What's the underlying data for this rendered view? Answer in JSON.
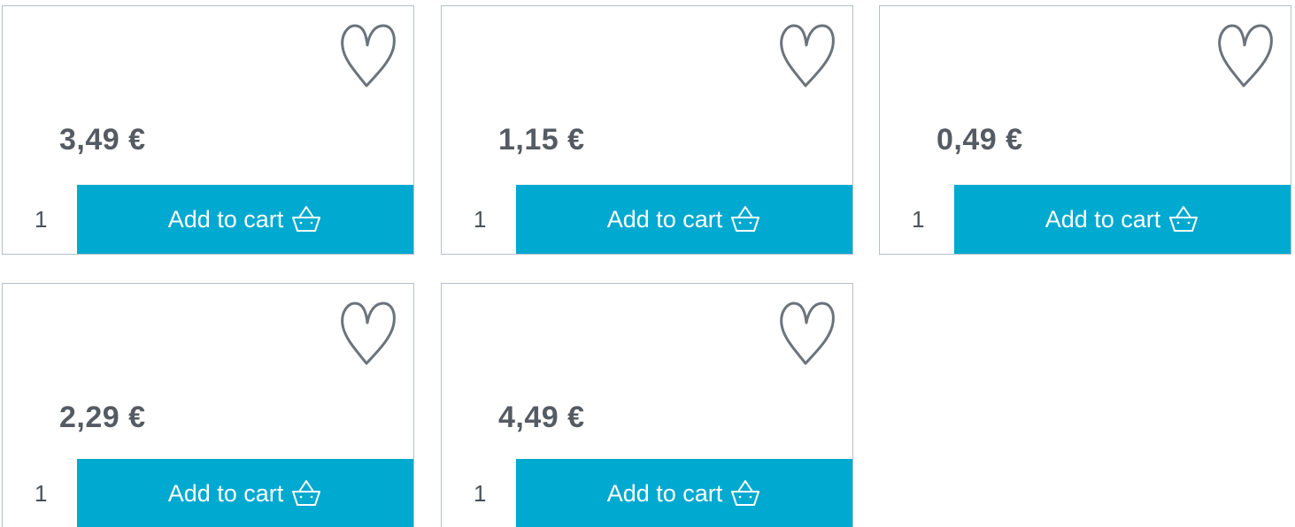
{
  "products": [
    {
      "price": "3,49 €",
      "quantity": "1",
      "add_to_cart_label": "Add to cart",
      "favorite_icon": "heart-outline-icon",
      "cart_icon": "basket-icon"
    },
    {
      "price": "1,15 €",
      "quantity": "1",
      "add_to_cart_label": "Add to cart",
      "favorite_icon": "heart-outline-icon",
      "cart_icon": "basket-icon"
    },
    {
      "price": "0,49 €",
      "quantity": "1",
      "add_to_cart_label": "Add to cart",
      "favorite_icon": "heart-outline-icon",
      "cart_icon": "basket-icon"
    },
    {
      "price": "2,29 €",
      "quantity": "1",
      "add_to_cart_label": "Add to cart",
      "favorite_icon": "heart-outline-icon",
      "cart_icon": "basket-icon"
    },
    {
      "price": "4,49 €",
      "quantity": "1",
      "add_to_cart_label": "Add to cart",
      "favorite_icon": "heart-outline-icon",
      "cart_icon": "basket-icon"
    }
  ],
  "colors": {
    "accent": "#00a9cf",
    "price_text": "#555b62",
    "border": "#b5bfc7",
    "icon_stroke": "#6b737b"
  }
}
